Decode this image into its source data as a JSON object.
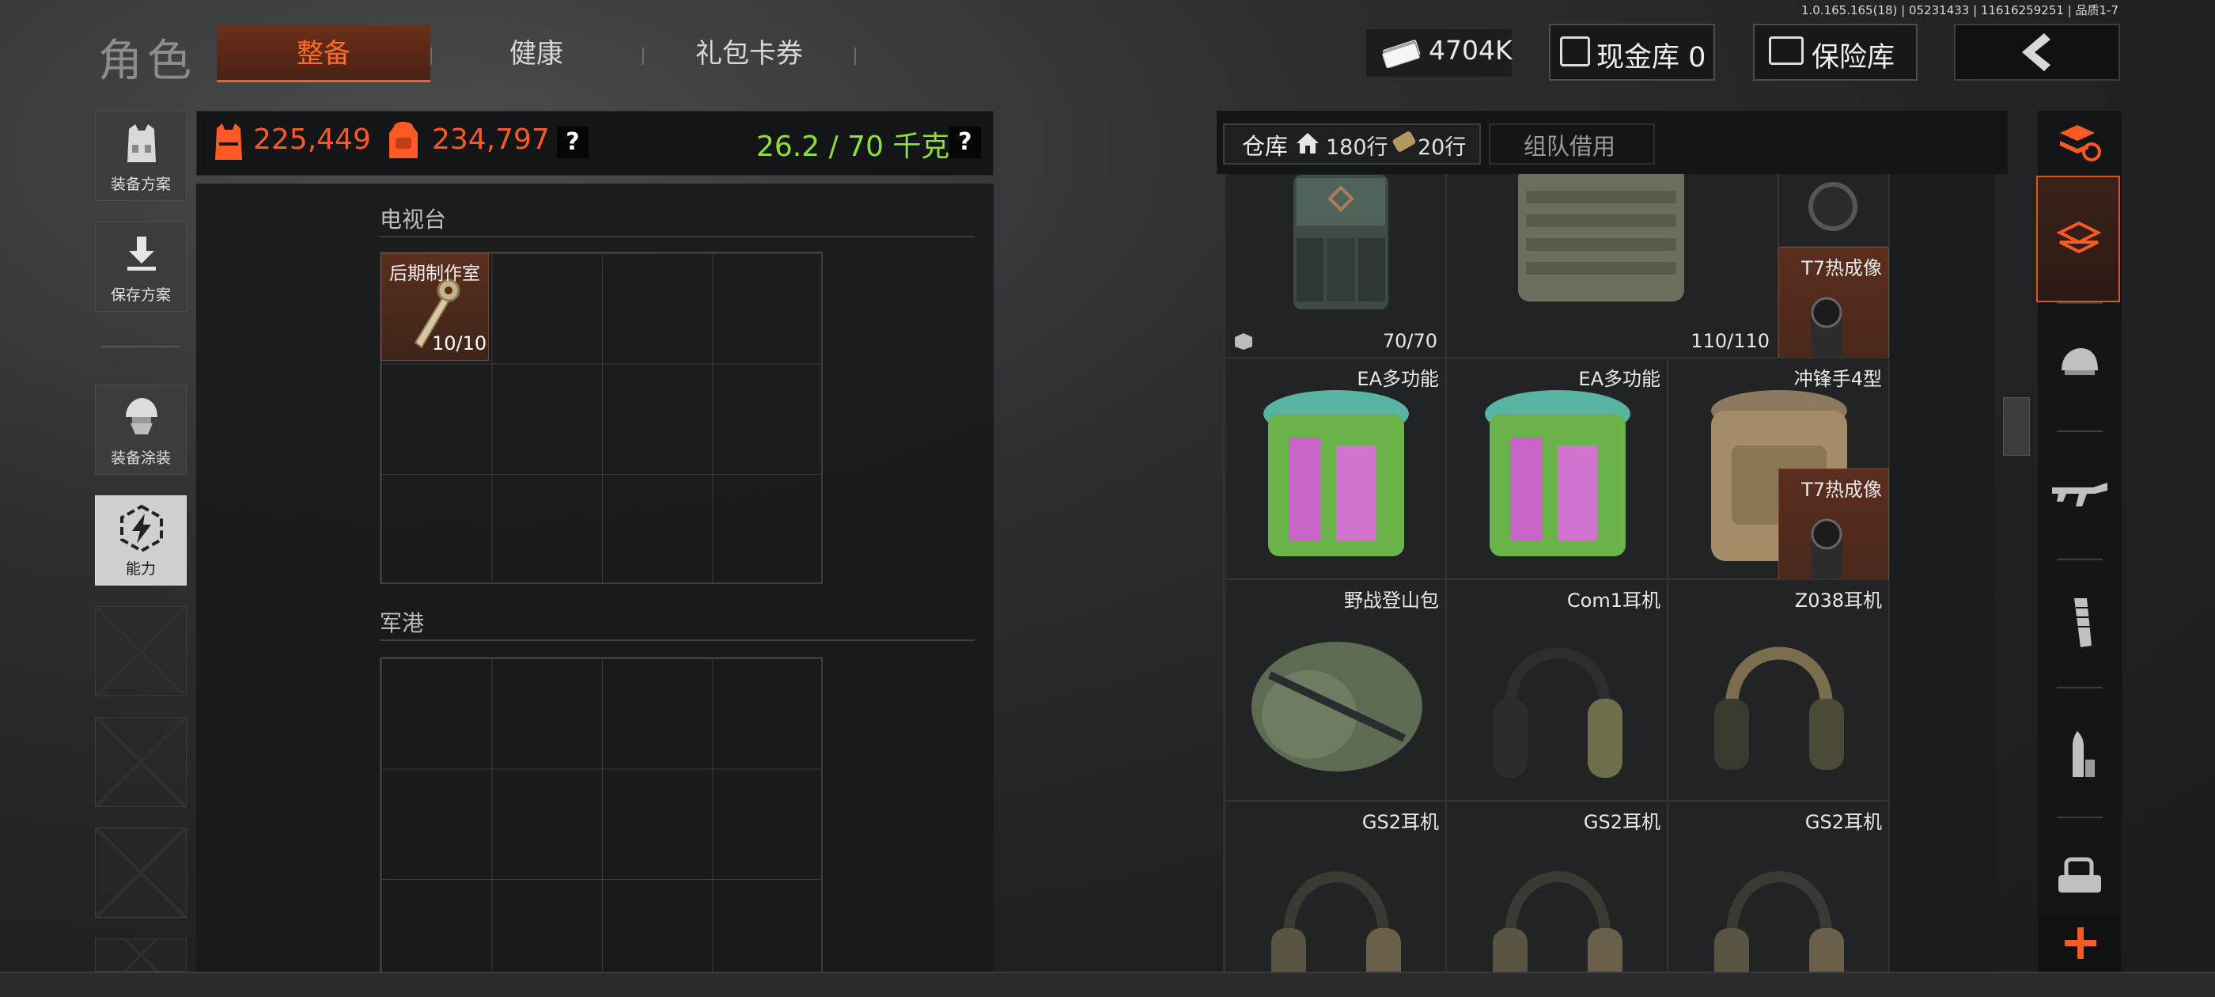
{
  "version_text": "1.0.165.165(18) | 05231433 | 11616259251 | 品质1-7",
  "title": "角色",
  "tabs": [
    {
      "label": "整备",
      "active": true
    },
    {
      "label": "健康",
      "active": false
    },
    {
      "label": "礼包卡券",
      "active": false
    }
  ],
  "currency": {
    "amount": "4704K"
  },
  "cash_vault": {
    "label": "现金库 0"
  },
  "insurance": {
    "label": "保险库"
  },
  "sidebar": {
    "items": [
      {
        "label": "装备方案",
        "icon": "vest-icon"
      },
      {
        "label": "保存方案",
        "icon": "download-icon"
      },
      {
        "label": "装备涂装",
        "icon": "helmet-icon"
      },
      {
        "label": "能力",
        "icon": "lightning-hex-icon",
        "active": true
      }
    ]
  },
  "stats": {
    "armor_value": "225,449",
    "bag_value": "234,797",
    "weight": "26.2 / 70 千克",
    "help": "?"
  },
  "loadout": {
    "sections": [
      {
        "title": "电视台",
        "items": [
          {
            "name": "后期制作室",
            "count": "10/10"
          }
        ]
      },
      {
        "title": "军港",
        "items": []
      }
    ]
  },
  "warehouse": {
    "tab_label": "仓库",
    "rows_home": "180行",
    "rows_ticket": "20行",
    "team_tab": "组队借用",
    "items": [
      {
        "name": "",
        "durability": "70/70",
        "type": "vest-green"
      },
      {
        "name": "",
        "durability": "110/110",
        "type": "vest-tan"
      },
      {
        "name": "",
        "durability": "",
        "type": "scope"
      },
      {
        "name": "T7热成像",
        "durability": "",
        "type": "thermal",
        "highlight": true
      },
      {
        "name": "EA多功能",
        "durability": "",
        "type": "pouch-pink"
      },
      {
        "name": "EA多功能",
        "durability": "",
        "type": "pouch-pink"
      },
      {
        "name": "冲锋手4型",
        "durability": "",
        "type": "pouch-tan"
      },
      {
        "name": "T7热成像",
        "durability": "",
        "type": "thermal",
        "highlight": true
      },
      {
        "name": "野战登山包",
        "durability": "",
        "type": "backpack"
      },
      {
        "name": "Com1耳机",
        "durability": "",
        "type": "headset-green"
      },
      {
        "name": "Z038耳机",
        "durability": "",
        "type": "headset-camo"
      },
      {
        "name": "GS2耳机",
        "durability": "",
        "type": "headset-tan"
      },
      {
        "name": "GS2耳机",
        "durability": "",
        "type": "headset-tan"
      },
      {
        "name": "GS2耳机",
        "durability": "",
        "type": "headset-tan"
      }
    ]
  },
  "rail": {
    "items": [
      "stack-refresh-icon",
      "layers-icon",
      "helmet-icon",
      "rifle-icon",
      "magazine-icon",
      "ammo-icon",
      "sight-icon",
      "plus-icon"
    ]
  },
  "colors": {
    "accent": "#ff5a26",
    "weight_ok": "#8de03c"
  }
}
